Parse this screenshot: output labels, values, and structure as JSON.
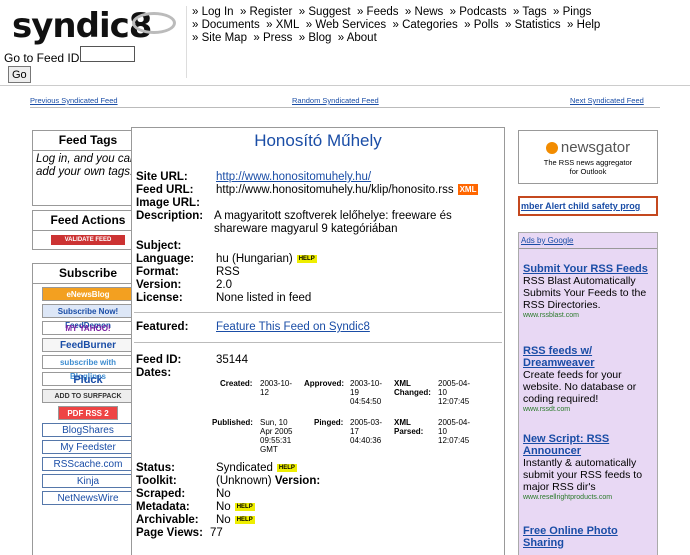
{
  "header": {
    "logo_text": "syndic8",
    "feedid_label": "Go to Feed ID:",
    "feedid_value": "",
    "go_label": "Go",
    "nav": [
      [
        "» Log In",
        "» Register",
        "» Suggest",
        "» Feeds",
        "» News",
        "» Podcasts",
        "» Tags",
        "» Pings"
      ],
      [
        "» Documents",
        "» XML",
        "» Web Services",
        "» Categories",
        "» Polls",
        "» Statistics",
        "» Help"
      ],
      [
        "» Site Map",
        "» Press",
        "» Blog",
        "» About"
      ]
    ]
  },
  "feednav": {
    "prev": "Previous Syndicated Feed",
    "random": "Random Syndicated Feed",
    "next": "Next Syndicated Feed"
  },
  "left": {
    "tags_title": "Feed Tags",
    "tags_text": "Log in, and you can add your own tags!",
    "actions_title": "Feed Actions",
    "validate_badge": "VALIDATE FEED",
    "subscribe_title": "Subscribe",
    "subscribe_buttons": [
      "eNewsBlog",
      "Subscribe Now! FeedDemon",
      "MY YAHOO!",
      "FeedBurner",
      "subscribe with Bloglines",
      "Pluck",
      "ADD TO SURFPACK",
      "PDF RSS 2 PDF"
    ],
    "subscribe_links": [
      "BlogShares",
      "My Feedster",
      "RSScache.com",
      "Kinja",
      "NetNewsWire"
    ]
  },
  "main": {
    "title": "Honosító Műhely",
    "site_url_label": "Site URL:",
    "site_url": "http://www.honositomuhely.hu/",
    "feed_url_label": "Feed URL:",
    "feed_url": "http://www.honositomuhely.hu/klip/honosito.rss",
    "xml_badge": "XML",
    "image_url_label": "Image URL:",
    "description_label": "Description:",
    "description_1": "A magyaritott szoftverek lelőhelye: freeware és",
    "description_2": "shareware magyarul 9 kategóriában",
    "subject_label": "Subject:",
    "language_label": "Language:",
    "language": "hu (Hungarian)",
    "format_label": "Format:",
    "format": "RSS",
    "version_label": "Version:",
    "version": "2.0",
    "license_label": "License:",
    "license": "None listed in feed",
    "featured_label": "Featured:",
    "featured_link": "Feature This Feed on Syndic8",
    "feed_id_label": "Feed ID:",
    "feed_id": "35144",
    "dates_label": "Dates:",
    "created_label": "Created:",
    "created": [
      "2003-10-",
      "12"
    ],
    "approved_label": "Approved:",
    "approved": [
      "2003-10-",
      "19",
      "04:54:50"
    ],
    "xml_changed_label": [
      "XML",
      "Changed:"
    ],
    "xml_changed": [
      "2005-04-",
      "10",
      "12:07:45"
    ],
    "published_label": "Published:",
    "published": [
      "Sun, 10",
      "Apr 2005",
      "09:55:31",
      "GMT"
    ],
    "pinged_label": "Pinged:",
    "pinged": [
      "2005-03-",
      "17",
      "04:40:36"
    ],
    "xml_parsed_label": [
      "XML",
      "Parsed:"
    ],
    "xml_parsed": [
      "2005-04-",
      "10",
      "12:07:45"
    ],
    "status_label": "Status:",
    "status": "Syndicated",
    "toolkit_label": "Toolkit:",
    "toolkit": "(Unknown)",
    "version2_label": "Version:",
    "scraped_label": "Scraped:",
    "scraped": "No",
    "metadata_label": "Metadata:",
    "metadata": "No",
    "archivable_label": "Archivable:",
    "archivable": "No",
    "pageviews_label": "Page Views:",
    "pageviews": "77",
    "help_badge": "HELP"
  },
  "right": {
    "newsgator_logo": "newsgator",
    "newsgator_text_1": "The RSS news aggregator",
    "newsgator_text_2": "for Outlook",
    "amber": "mber Alert child safety prog",
    "ads_label": "Ads by Google",
    "ads": [
      {
        "title": "Submit Your RSS Feeds",
        "text": "RSS Blast Automatically Submits Your Feeds to the RSS Directories.",
        "url": "www.rssblast.com"
      },
      {
        "title": "RSS feeds w/ Dreamweaver",
        "text": "Create feeds for your website. No database or coding required!",
        "url": "www.rssdt.com"
      },
      {
        "title": "New Script: RSS Announcer",
        "text": "Instantly & automatically submit your RSS feeds to major RSS dir's",
        "url": "www.resellrightproducts.com"
      },
      {
        "title": "Free Online Photo Sharing",
        "text": "",
        "url": ""
      }
    ]
  },
  "colors": {
    "link": "#1a4da6",
    "xml_badge": "#ff6600",
    "help_badge": "#eeee00",
    "ads_bg": "#e8d8f4",
    "amber_border": "#c4481f"
  }
}
